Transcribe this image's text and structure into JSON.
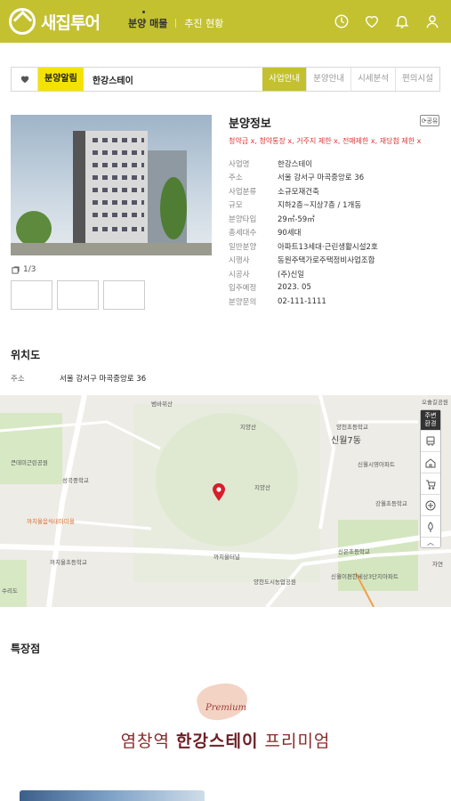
{
  "header": {
    "logo_text": "새집투어",
    "nav": [
      "분양 매물",
      "추진 현황"
    ],
    "icons": [
      "history-icon",
      "heart-icon",
      "bell-icon",
      "user-icon"
    ]
  },
  "crumb": {
    "badge": "분양알림",
    "name": "한강스테이",
    "tabs": [
      "사업안내",
      "분양안내",
      "시세분석",
      "편의시설"
    ]
  },
  "gallery": {
    "counter": "1/3"
  },
  "info": {
    "title": "분양정보",
    "share": "공유",
    "tags": "청약금 x, 청약통장 x, 거주지 제한 x, 전매제한 x, 재당첨 제한 x",
    "rows": [
      {
        "k": "사업명",
        "v": "한강스테이"
      },
      {
        "k": "주소",
        "v": "서울 강서구 마곡중앙로 36"
      },
      {
        "k": "사업분류",
        "v": "소규모재건축"
      },
      {
        "k": "규모",
        "v": "지하2층~지상7층 / 1개동"
      },
      {
        "k": "분양타입",
        "v": "29㎡-59㎡"
      },
      {
        "k": "총세대수",
        "v": "90세대"
      },
      {
        "k": "일반분양",
        "v": "아파트13세대·근린생활시설2호"
      },
      {
        "k": "시행사",
        "v": "동원주택가로주택정비사업조합"
      },
      {
        "k": "시공사",
        "v": "(주)신일"
      },
      {
        "k": "입주예정",
        "v": "2023. 05"
      },
      {
        "k": "분양문의",
        "v": "02-111-1111"
      }
    ]
  },
  "location": {
    "title": "위치도",
    "addr_label": "주소",
    "addr": "서울 강서구 마곡중앙로 36"
  },
  "map": {
    "labels": [
      "범바위산",
      "오솔길공원",
      "지양산",
      "신월7동",
      "양천초등학교",
      "큰데미근린공원",
      "신월시영아파트",
      "성곡중학교",
      "지양산",
      "강월초등학교",
      "까치울음식테마마을",
      "까치울초등학교",
      "까치울터널",
      "신은초등학교",
      "양천도시농업공원",
      "신월이편한세상3단지아파트",
      "수리도",
      "자연"
    ],
    "rail_head": "주변\n환경"
  },
  "features": {
    "title": "특장점"
  },
  "promo": {
    "premium": "Premium",
    "pre": "염창역 ",
    "brand": "한강스테이",
    "post": " 프리미엄"
  }
}
